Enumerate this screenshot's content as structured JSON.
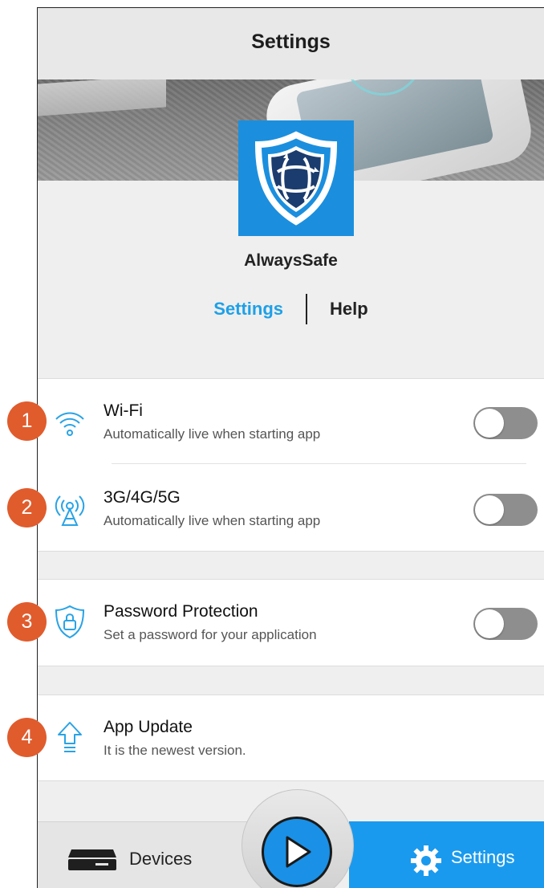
{
  "header": {
    "title": "Settings"
  },
  "app": {
    "name": "AlwaysSafe"
  },
  "segmented": {
    "active": "Settings",
    "inactive": "Help"
  },
  "network": {
    "wifi": {
      "label": "Wi-Fi",
      "sub": "Automatically live when starting app",
      "enabled": false
    },
    "cellular": {
      "label": "3G/4G/5G",
      "sub": "Automatically live when starting app",
      "enabled": false
    }
  },
  "security": {
    "password": {
      "label": "Password Protection",
      "sub": "Set a password for your application",
      "enabled": false
    }
  },
  "update": {
    "label": "App Update",
    "sub": "It is the newest version."
  },
  "tabbar": {
    "devices": "Devices",
    "settings": "Settings"
  },
  "callouts": [
    "1",
    "2",
    "3",
    "4"
  ],
  "colors": {
    "accent": "#1a9aee",
    "callout": "#e05c2d",
    "toggle_off": "#8e8e8e"
  }
}
